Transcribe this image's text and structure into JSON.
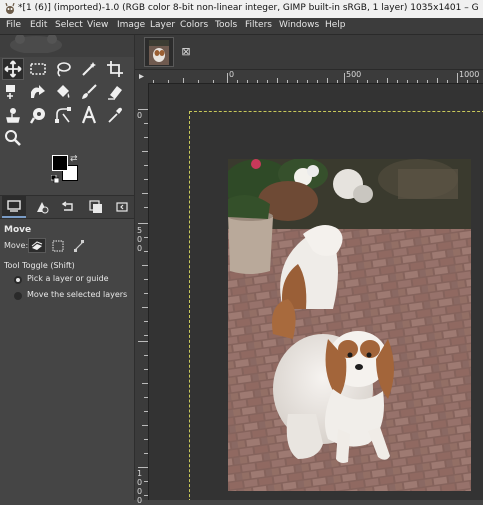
{
  "window": {
    "title": "*[1 (6)] (imported)-1.0 (RGB color 8-bit non-linear integer, GIMP built-in sRGB, 1 layer) 1035x1401 – GIMP"
  },
  "menu": [
    "File",
    "Edit",
    "Select",
    "View",
    "Image",
    "Layer",
    "Colors",
    "Tools",
    "Filters",
    "Windows",
    "Help"
  ],
  "toolbox": {
    "tools": [
      "move-tool-icon",
      "rect-select-icon",
      "free-select-icon",
      "fuzzy-select-icon",
      "crop-icon",
      "unified-transform-icon",
      "warp-transform-icon",
      "bucket-fill-icon",
      "paintbrush-icon",
      "eraser-icon",
      "clone-icon",
      "smudge-icon",
      "paths-icon",
      "text-icon",
      "color-picker-icon",
      "zoom-icon"
    ],
    "active_tool": "move-tool-icon",
    "fg_color": "#000000",
    "bg_color": "#ffffff"
  },
  "dock_tabs": [
    "tool-options-icon",
    "device-status-icon",
    "undo-history-icon",
    "images-icon",
    "configure-icon"
  ],
  "tool_options": {
    "title": "Move",
    "move_label": "Move:",
    "toggle_label": "Tool Toggle  (Shift)",
    "options": [
      {
        "label": "Pick a layer or guide",
        "selected": true
      },
      {
        "label": "Move the selected layers",
        "selected": false
      }
    ]
  },
  "image_tabs": {
    "close_glyph": "⊠"
  },
  "ruler": {
    "top_labels": [
      "0",
      "500",
      "1000"
    ],
    "left_labels": [
      "0",
      "5",
      "0",
      "0",
      "1",
      "0",
      "0",
      "0"
    ]
  },
  "colors": {
    "background": "#454545",
    "canvas": "#333333",
    "boundary": "#c9c95a"
  }
}
